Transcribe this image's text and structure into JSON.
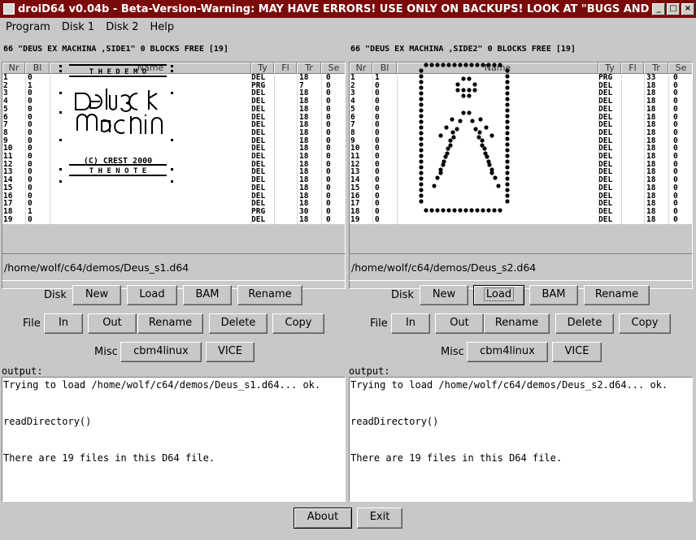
{
  "window": {
    "title": "droiD64 v0.04b - Beta-Version-Warning: MAY HAVE ERRORS! USE ONLY ON BACKUPS! LOOK AT \"BUGS AND TO-DO\"!"
  },
  "menu": [
    "Program",
    "Disk 1",
    "Disk 2",
    "Help"
  ],
  "columns": [
    "Nr",
    "Bl",
    "Name",
    "Ty",
    "Fl",
    "Tr",
    "Se"
  ],
  "disks": [
    {
      "header": "66 \"DEUS EX MACHINA ,SIDE1\" 0 BLOCKS FREE [19]",
      "path": "/home/wolf/c64/demos/Deus_s1.d64",
      "rows": [
        {
          "nr": "1",
          "bl": "0",
          "ty": "DEL",
          "tr": "18",
          "se": "0"
        },
        {
          "nr": "2",
          "bl": "1",
          "ty": "PRG",
          "tr": "7",
          "se": "0"
        },
        {
          "nr": "3",
          "bl": "0",
          "ty": "DEL",
          "tr": "18",
          "se": "0"
        },
        {
          "nr": "4",
          "bl": "0",
          "ty": "DEL",
          "tr": "18",
          "se": "0"
        },
        {
          "nr": "5",
          "bl": "0",
          "ty": "DEL",
          "tr": "18",
          "se": "0"
        },
        {
          "nr": "6",
          "bl": "0",
          "ty": "DEL",
          "tr": "18",
          "se": "0"
        },
        {
          "nr": "7",
          "bl": "0",
          "ty": "DEL",
          "tr": "18",
          "se": "0"
        },
        {
          "nr": "8",
          "bl": "0",
          "ty": "DEL",
          "tr": "18",
          "se": "0"
        },
        {
          "nr": "9",
          "bl": "0",
          "ty": "DEL",
          "tr": "18",
          "se": "0"
        },
        {
          "nr": "10",
          "bl": "0",
          "ty": "DEL",
          "tr": "18",
          "se": "0"
        },
        {
          "nr": "11",
          "bl": "0",
          "ty": "DEL",
          "tr": "18",
          "se": "0"
        },
        {
          "nr": "12",
          "bl": "0",
          "ty": "DEL",
          "tr": "18",
          "se": "0"
        },
        {
          "nr": "13",
          "bl": "0",
          "ty": "DEL",
          "tr": "18",
          "se": "0"
        },
        {
          "nr": "14",
          "bl": "0",
          "ty": "DEL",
          "tr": "18",
          "se": "0"
        },
        {
          "nr": "15",
          "bl": "0",
          "ty": "DEL",
          "tr": "18",
          "se": "0"
        },
        {
          "nr": "16",
          "bl": "0",
          "ty": "DEL",
          "tr": "18",
          "se": "0"
        },
        {
          "nr": "17",
          "bl": "0",
          "ty": "DEL",
          "tr": "18",
          "se": "0"
        },
        {
          "nr": "18",
          "bl": "1",
          "ty": "PRG",
          "tr": "30",
          "se": "0"
        },
        {
          "nr": "19",
          "bl": "0",
          "ty": "DEL",
          "tr": "18",
          "se": "0"
        }
      ],
      "name_art": {
        "line1": "T H E   D E M O",
        "credit": "(C) CREST 2000",
        "line2": "T H E   N O T E"
      },
      "output": [
        "Trying to load /home/wolf/c64/demos/Deus_s1.d64... ok.",
        "",
        "",
        "readDirectory()",
        "",
        "",
        "There are 19 files in this D64 file."
      ]
    },
    {
      "header": "66 \"DEUS EX MACHINA ,SIDE2\" 0 BLOCKS FREE [19]",
      "path": "/home/wolf/c64/demos/Deus_s2.d64",
      "rows": [
        {
          "nr": "1",
          "bl": "1",
          "ty": "PRG",
          "tr": "33",
          "se": "0"
        },
        {
          "nr": "2",
          "bl": "0",
          "ty": "DEL",
          "tr": "18",
          "se": "0"
        },
        {
          "nr": "3",
          "bl": "0",
          "ty": "DEL",
          "tr": "18",
          "se": "0"
        },
        {
          "nr": "4",
          "bl": "0",
          "ty": "DEL",
          "tr": "18",
          "se": "0"
        },
        {
          "nr": "5",
          "bl": "0",
          "ty": "DEL",
          "tr": "18",
          "se": "0"
        },
        {
          "nr": "6",
          "bl": "0",
          "ty": "DEL",
          "tr": "18",
          "se": "0"
        },
        {
          "nr": "7",
          "bl": "0",
          "ty": "DEL",
          "tr": "18",
          "se": "0"
        },
        {
          "nr": "8",
          "bl": "0",
          "ty": "DEL",
          "tr": "18",
          "se": "0"
        },
        {
          "nr": "9",
          "bl": "0",
          "ty": "DEL",
          "tr": "18",
          "se": "0"
        },
        {
          "nr": "10",
          "bl": "0",
          "ty": "DEL",
          "tr": "18",
          "se": "0"
        },
        {
          "nr": "11",
          "bl": "0",
          "ty": "DEL",
          "tr": "18",
          "se": "0"
        },
        {
          "nr": "12",
          "bl": "0",
          "ty": "DEL",
          "tr": "18",
          "se": "0"
        },
        {
          "nr": "13",
          "bl": "0",
          "ty": "DEL",
          "tr": "18",
          "se": "0"
        },
        {
          "nr": "14",
          "bl": "0",
          "ty": "DEL",
          "tr": "18",
          "se": "0"
        },
        {
          "nr": "15",
          "bl": "0",
          "ty": "DEL",
          "tr": "18",
          "se": "0"
        },
        {
          "nr": "16",
          "bl": "0",
          "ty": "DEL",
          "tr": "18",
          "se": "0"
        },
        {
          "nr": "17",
          "bl": "0",
          "ty": "DEL",
          "tr": "18",
          "se": "0"
        },
        {
          "nr": "18",
          "bl": "0",
          "ty": "DEL",
          "tr": "18",
          "se": "0"
        },
        {
          "nr": "19",
          "bl": "0",
          "ty": "DEL",
          "tr": "18",
          "se": "0"
        }
      ],
      "output": [
        "Trying to load /home/wolf/c64/demos/Deus_s2.d64... ok.",
        "",
        "",
        "readDirectory()",
        "",
        "",
        "There are 19 files in this D64 file."
      ]
    }
  ],
  "buttons": {
    "disk_label": "Disk",
    "file_label": "File",
    "misc_label": "Misc",
    "new": "New",
    "load": "Load",
    "bam": "BAM",
    "rename": "Rename",
    "in": "In",
    "out": "Out",
    "delete": "Delete",
    "copy": "Copy",
    "cbm4linux": "cbm4linux",
    "vice": "VICE",
    "output_label": "output:"
  },
  "footer": {
    "about": "About",
    "exit": "Exit"
  }
}
